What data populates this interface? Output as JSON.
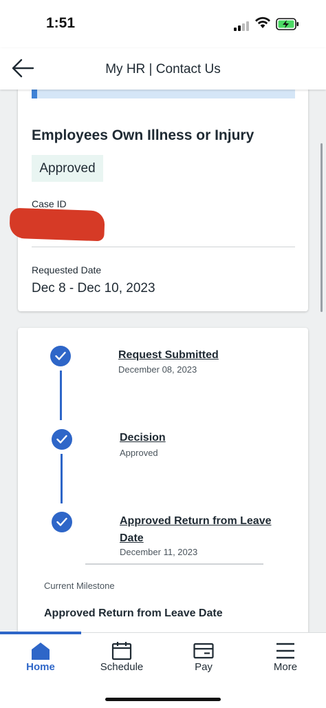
{
  "status_bar": {
    "time": "1:51"
  },
  "header": {
    "title": "My HR | Contact Us"
  },
  "case": {
    "title": "Employees Own Illness or Injury",
    "status": "Approved",
    "case_id_label": "Case ID",
    "requested_date_label": "Requested Date",
    "requested_date_value": "Dec 8 - Dec 10, 2023"
  },
  "timeline": {
    "steps": [
      {
        "title": "Request Submitted",
        "subtitle": "December 08, 2023"
      },
      {
        "title": "Decision",
        "subtitle": "Approved"
      },
      {
        "title_line1": "Approved Return from Leave",
        "title_line2": "Date",
        "subtitle": "December 11, 2023"
      }
    ],
    "current_milestone_label": "Current Milestone",
    "current_milestone_value": "Approved Return from Leave Date"
  },
  "tabbar": {
    "items": [
      {
        "label": "Home",
        "icon": "home-icon",
        "active": true
      },
      {
        "label": "Schedule",
        "icon": "calendar-icon"
      },
      {
        "label": "Pay",
        "icon": "wallet-icon"
      },
      {
        "label": "More",
        "icon": "menu-icon"
      }
    ]
  },
  "colors": {
    "accent": "#2e66c8",
    "badge_bg": "#e9f5f2",
    "redaction": "#d63a26"
  }
}
